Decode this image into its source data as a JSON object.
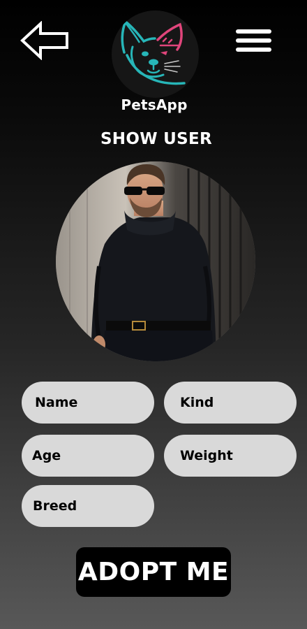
{
  "header": {
    "back_icon": "arrow-left-outline-icon",
    "menu_icon": "hamburger-menu-icon",
    "logo_icon": "french-bulldog-logo-icon",
    "app_name": "PetsApp"
  },
  "page": {
    "title": "SHOW USER"
  },
  "profile": {
    "photo": "user-profile-photo"
  },
  "fields": {
    "name": "Name",
    "kind": "Kind",
    "age": "Age",
    "weight": "Weight",
    "breed": "Breed"
  },
  "actions": {
    "adopt_label": "ADOPT ME"
  },
  "colors": {
    "field_bg": "#d9d9d9",
    "button_bg": "#000000",
    "logo_teal": "#27b6b8",
    "logo_pink": "#e0457b"
  }
}
